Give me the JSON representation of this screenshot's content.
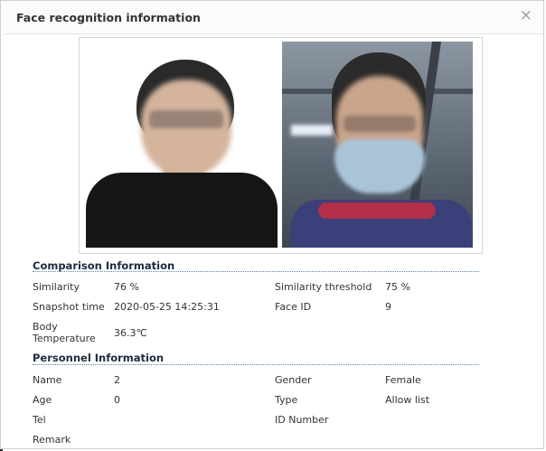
{
  "dialog": {
    "title": "Face recognition information",
    "close_glyph": "×"
  },
  "photos": {
    "registered": "registered-face-photo",
    "snapshot": "snapshot-face-photo"
  },
  "comparison": {
    "heading": "Comparison Information",
    "rows": [
      {
        "label": "Similarity",
        "value": "76 %",
        "label2": "Similarity threshold",
        "value2": "75 %"
      },
      {
        "label": "Snapshot time",
        "value": "2020-05-25 14:25:31",
        "label2": "Face ID",
        "value2": "9"
      },
      {
        "label": "Body Temperature",
        "value": "36.3℃"
      }
    ]
  },
  "personnel": {
    "heading": "Personnel Information",
    "rows": [
      {
        "label": "Name",
        "value": "2",
        "label2": "Gender",
        "value2": "Female"
      },
      {
        "label": "Age",
        "value": "0",
        "label2": "Type",
        "value2": "Allow list"
      },
      {
        "label": "Tel",
        "value": "",
        "label2": "ID Number",
        "value2": ""
      },
      {
        "label": "Remark",
        "value": ""
      }
    ]
  }
}
